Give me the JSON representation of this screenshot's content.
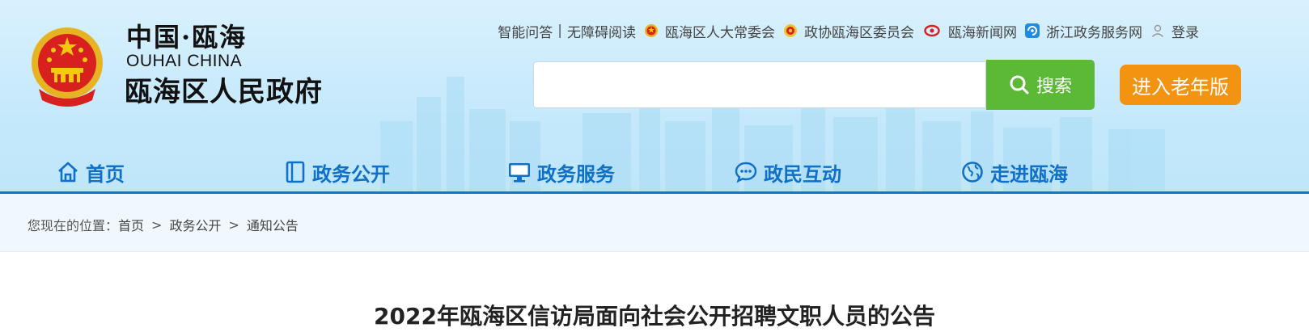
{
  "logo": {
    "cn_name": "中国·瓯海",
    "en_name": "OUHAI CHINA",
    "site_title": "瓯海区人民政府"
  },
  "toplinks": {
    "qa": "智能问答",
    "separator": "|",
    "accessible": "无障碍阅读",
    "congress": "瓯海区人大常委会",
    "cppcc": "政协瓯海区委员会",
    "news": "瓯海新闻网",
    "zjservice": "浙江政务服务网",
    "login": "登录"
  },
  "search": {
    "placeholder": "",
    "button_label": "搜索"
  },
  "elder_mode_label": "进入老年版",
  "nav": {
    "home": "首页",
    "open_gov": "政务公开",
    "services": "政务服务",
    "interaction": "政民互动",
    "about": "走进瓯海"
  },
  "breadcrumb": {
    "prefix": "您现在的位置：",
    "items": [
      "首页",
      "政务公开",
      "通知公告"
    ],
    "separator": ">"
  },
  "article": {
    "title": "2022年瓯海区信访局面向社会公开招聘文职人员的公告"
  },
  "colors": {
    "nav_blue": "#1070c8",
    "search_green": "#5bb935",
    "elder_orange": "#f39312",
    "header_bg": "#c6e9fb"
  },
  "icons": {
    "congress": "emblem-icon",
    "cppcc": "cppcc-icon",
    "news": "news-icon",
    "zjservice": "zj-service-icon",
    "login": "user-icon",
    "search": "search-icon",
    "home": "home-icon",
    "open_gov": "document-icon",
    "services": "monitor-icon",
    "interaction": "chat-icon",
    "about": "globe-icon"
  }
}
